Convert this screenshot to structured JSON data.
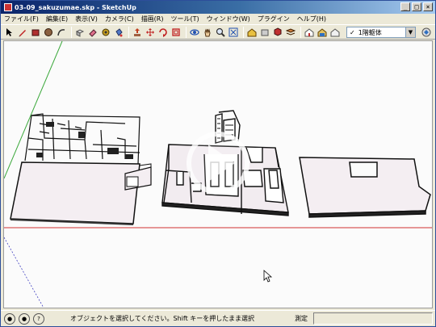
{
  "window": {
    "title": "03-09_sakuzumae.skp - SketchUp",
    "buttons": [
      "_",
      "□",
      "×"
    ]
  },
  "menu": [
    "ファイル(F)",
    "編集(E)",
    "表示(V)",
    "カメラ(C)",
    "描画(R)",
    "ツール(T)",
    "ウィンドウ(W)",
    "プラグイン",
    "ヘルプ(H)"
  ],
  "toolbar": {
    "tools": [
      "select-icon",
      "pencil-icon",
      "rectangle-icon",
      "circle-icon",
      "arc-icon",
      "make-component-icon",
      "eraser-icon",
      "tape-measure-icon",
      "paint-bucket-icon",
      "push-pull-icon",
      "move-icon",
      "rotate-icon",
      "offset-icon",
      "orbit-icon",
      "pan-icon",
      "zoom-icon",
      "zoom-extents-icon",
      "warehouse-icon",
      "share-icon",
      "component-icon",
      "layer-icon",
      "style-icon",
      "texture-icon",
      "house-icon"
    ],
    "layer_dropdown": {
      "check": "✓",
      "value": "1階躯体",
      "arrow": "▼"
    }
  },
  "viewport": {
    "background": "#fbfbfb",
    "axis_green": "#3aa83a",
    "axis_red": "#d03030",
    "axis_blue": "#4040c0",
    "play_button": "play-icon"
  },
  "status": {
    "icons": [
      "geo-icon",
      "credit-icon",
      "info-icon"
    ],
    "help_text": "オブジェクトを選択してください。Shift キーを押したまま選択",
    "measure_label": "測定",
    "measure_value": ""
  }
}
